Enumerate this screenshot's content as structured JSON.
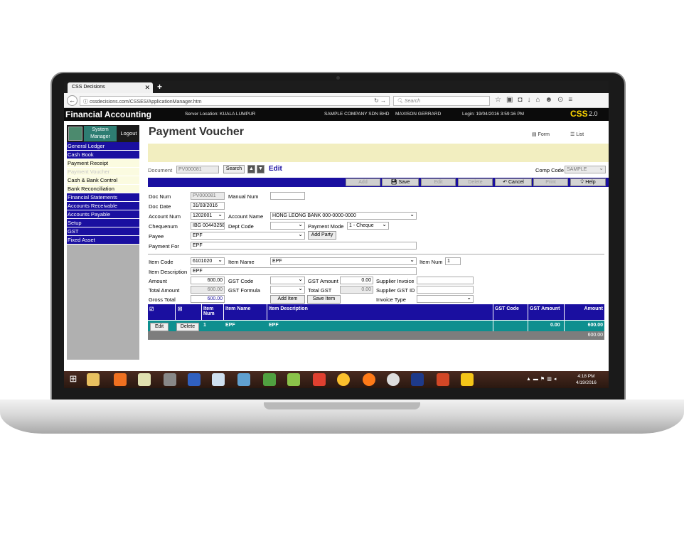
{
  "browser": {
    "tab_title": "CSS Decisions",
    "tab_close": "✕",
    "new_tab": "+",
    "url": "cssdecisions.com/CSSES/ApplicationManager.htm",
    "search_placeholder": "Search"
  },
  "app": {
    "title": "Financial Accounting",
    "server": "Server Location: KUALA LUMPUR",
    "company": "SAMPLE COMPANY SDN BHD",
    "user": "MAXISON GERRARD",
    "login": "Login: 19/04/2016 3:59:16 PM",
    "brand": "CSS",
    "brand_suffix": "2.0"
  },
  "sidebar": {
    "system_manager": "System Manager",
    "logout": "Logout",
    "items": [
      {
        "label": "General Ledger",
        "style": "blue"
      },
      {
        "label": "Cash Book",
        "style": "blue"
      },
      {
        "label": "Payment Receipt",
        "style": "yellow"
      },
      {
        "label": "Payment Voucher",
        "style": "disabled"
      },
      {
        "label": "Cash & Bank Control",
        "style": "yellow"
      },
      {
        "label": "Bank Reconciliation",
        "style": "yellow"
      },
      {
        "label": "Financial Statements",
        "style": "blue"
      },
      {
        "label": "Accounts Receivable",
        "style": "blue"
      },
      {
        "label": "Accounts Payable",
        "style": "blue"
      },
      {
        "label": "Setup",
        "style": "blue"
      },
      {
        "label": "GST",
        "style": "blue"
      },
      {
        "label": "Fixed Asset",
        "style": "blue"
      }
    ]
  },
  "page": {
    "title": "Payment Voucher",
    "form_link": "Form",
    "list_link": "List",
    "document_label": "Document",
    "document_value": "PV000081",
    "search_button": "Search",
    "mode": "Edit",
    "comp_code_label": "Comp Code",
    "comp_code_value": "SAMPLE"
  },
  "toolbar": {
    "add": "Add",
    "save": "Save",
    "edit": "Edit",
    "delete": "Delete",
    "cancel": "Cancel",
    "print": "Print",
    "help": "Help"
  },
  "form": {
    "doc_num_label": "Doc Num",
    "doc_num": "PV000081",
    "manual_num_label": "Manual Num",
    "manual_num": "",
    "doc_date_label": "Doc Date",
    "doc_date": "31/03/2016",
    "account_num_label": "Account Num",
    "account_num": "1202001",
    "account_name_label": "Account Name",
    "account_name": "HONG LEONG BANK 000-0000-0000",
    "chequenum_label": "Chequenum",
    "chequenum": "IBG 00443258",
    "dept_code_label": "Dept Code",
    "dept_code": "",
    "payment_mode_label": "Payment Mode",
    "payment_mode": "1 - Cheque",
    "payee_label": "Payee",
    "payee": "EPF",
    "add_party": "Add Party",
    "payment_for_label": "Payment For",
    "payment_for": "EPF"
  },
  "item": {
    "item_code_label": "Item Code",
    "item_code": "6101020",
    "item_name_label": "Item Name",
    "item_name": "EPF",
    "item_num_label": "Item Num",
    "item_num": "1",
    "item_desc_label": "Item Description",
    "item_desc": "EPF",
    "amount_label": "Amount",
    "amount": "600.00",
    "gst_code_label": "GST Code",
    "gst_code": "",
    "gst_amount_label": "GST Amount",
    "gst_amount": "0.00",
    "supplier_invoice_label": "Supplier Invoice",
    "supplier_invoice": "",
    "total_amount_label": "Total Amount",
    "total_amount": "600.00",
    "gst_formula_label": "GST Formula",
    "gst_formula": "",
    "total_gst_label": "Total GST",
    "total_gst": "0.00",
    "supplier_gst_label": "Supplier GST ID",
    "supplier_gst": "",
    "gross_total_label": "Gross Total",
    "gross_total": "600.00",
    "add_item": "Add Item",
    "save_item": "Save Item",
    "invoice_type_label": "Invoice Type",
    "invoice_type": ""
  },
  "grid": {
    "headers": {
      "item_num": "Item Num",
      "item_name": "Item Name",
      "item_desc": "Item Description",
      "gst_code": "GST Code",
      "gst_amount": "GST Amount",
      "amount": "Amount"
    },
    "row": {
      "edit": "Edit",
      "delete": "Delete",
      "item_num": "1",
      "item_name": "EPF",
      "item_desc": "EPF",
      "gst_code": "",
      "gst_amount": "0.00",
      "amount": "600.00"
    },
    "total": "600.00"
  },
  "taskbar": {
    "time": "4:18 PM",
    "date": "4/19/2016"
  }
}
